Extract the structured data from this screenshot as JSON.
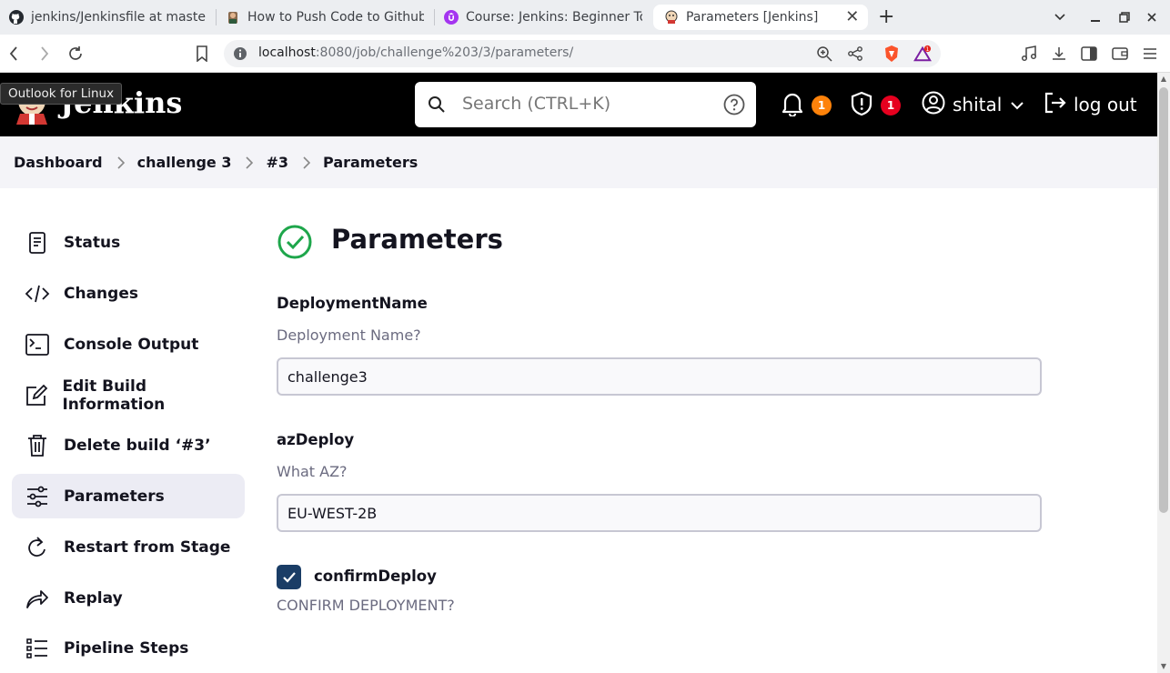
{
  "browser": {
    "tabs": [
      {
        "title": "jenkins/Jenkinsfile at maste",
        "icon": "github-icon"
      },
      {
        "title": "How to Push Code to Github",
        "icon": "avatar-icon"
      },
      {
        "title": "Course: Jenkins: Beginner To",
        "icon": "udemy-icon"
      },
      {
        "title": "Parameters [Jenkins]",
        "icon": "jenkins-icon"
      }
    ],
    "url_host": "localhost",
    "url_path": ":8080/job/challenge%203/3/parameters/",
    "brave_badge": "1",
    "tooltip": "Outlook for Linux"
  },
  "header": {
    "title": "Jenkins",
    "search_placeholder": "Search (CTRL+K)",
    "notifications_count": "1",
    "security_count": "1",
    "user": "shital",
    "logout": "log out"
  },
  "breadcrumb": [
    "Dashboard",
    "challenge 3",
    "#3",
    "Parameters"
  ],
  "sidebar": {
    "items": [
      {
        "label": "Status",
        "icon": "document-icon"
      },
      {
        "label": "Changes",
        "icon": "code-icon"
      },
      {
        "label": "Console Output",
        "icon": "terminal-icon"
      },
      {
        "label": "Edit Build Information",
        "icon": "edit-icon"
      },
      {
        "label": "Delete build ‘#3’",
        "icon": "trash-icon"
      },
      {
        "label": "Parameters",
        "icon": "sliders-icon",
        "active": true
      },
      {
        "label": "Restart from Stage",
        "icon": "restart-icon"
      },
      {
        "label": "Replay",
        "icon": "replay-icon"
      },
      {
        "label": "Pipeline Steps",
        "icon": "list-icon"
      }
    ]
  },
  "main": {
    "title": "Parameters",
    "params": [
      {
        "name": "DeploymentName",
        "description": "Deployment Name?",
        "value": "challenge3"
      },
      {
        "name": "azDeploy",
        "description": "What AZ?",
        "value": "EU-WEST-2B"
      }
    ],
    "checkbox": {
      "name": "confirmDeploy",
      "description": "CONFIRM DEPLOYMENT?",
      "checked": true
    }
  },
  "colors": {
    "header_bg": "#000000",
    "success": "#1ea64b",
    "checkbox": "#1a3d66",
    "active_item": "#ececf4"
  }
}
